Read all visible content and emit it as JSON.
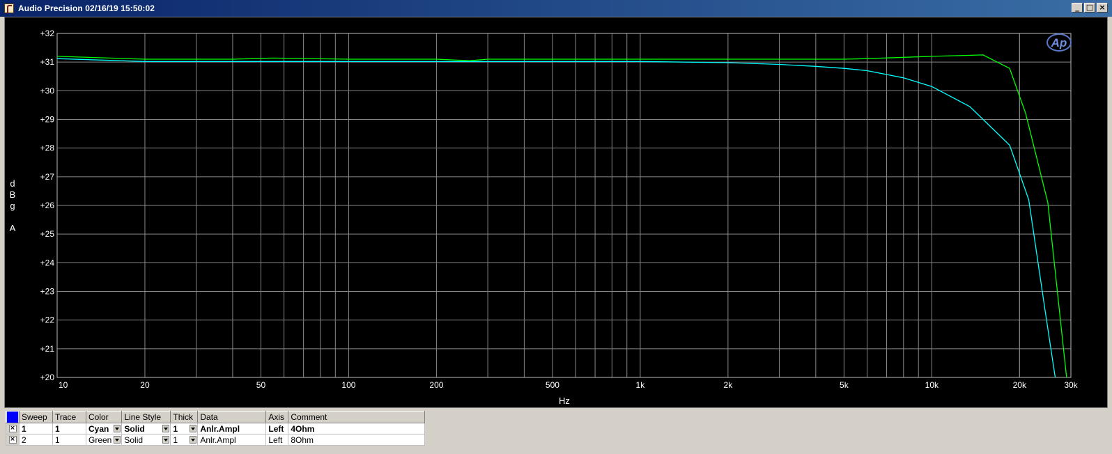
{
  "window": {
    "title": "Audio Precision  02/16/19 15:50:02",
    "minimize_glyph": "_",
    "maximize_glyph": "□",
    "close_glyph": "×"
  },
  "chart_data": {
    "type": "line",
    "title": "",
    "xlabel": "Hz",
    "ylabel": "dBgA",
    "ylabel_chars": [
      "d",
      "B",
      "g",
      "",
      "A"
    ],
    "xscale": "log",
    "xlim": [
      10,
      30000
    ],
    "ylim": [
      20,
      32
    ],
    "grid": true,
    "logo": "Ap",
    "y_ticks": [
      {
        "v": 20,
        "label": "+20"
      },
      {
        "v": 21,
        "label": "+21"
      },
      {
        "v": 22,
        "label": "+22"
      },
      {
        "v": 23,
        "label": "+23"
      },
      {
        "v": 24,
        "label": "+24"
      },
      {
        "v": 25,
        "label": "+25"
      },
      {
        "v": 26,
        "label": "+26"
      },
      {
        "v": 27,
        "label": "+27"
      },
      {
        "v": 28,
        "label": "+28"
      },
      {
        "v": 29,
        "label": "+29"
      },
      {
        "v": 30,
        "label": "+30"
      },
      {
        "v": 31,
        "label": "+31"
      },
      {
        "v": 32,
        "label": "+32"
      }
    ],
    "x_ticks": [
      {
        "v": 10,
        "label": "10"
      },
      {
        "v": 20,
        "label": "20"
      },
      {
        "v": 50,
        "label": "50"
      },
      {
        "v": 100,
        "label": "100"
      },
      {
        "v": 200,
        "label": "200"
      },
      {
        "v": 500,
        "label": "500"
      },
      {
        "v": 1000,
        "label": "1k"
      },
      {
        "v": 2000,
        "label": "2k"
      },
      {
        "v": 5000,
        "label": "5k"
      },
      {
        "v": 10000,
        "label": "10k"
      },
      {
        "v": 20000,
        "label": "20k"
      },
      {
        "v": 30000,
        "label": "30k"
      }
    ],
    "series": [
      {
        "name": "4Ohm",
        "color": "#00ffff",
        "points": [
          [
            10,
            31.12
          ],
          [
            20,
            31.02
          ],
          [
            50,
            31.02
          ],
          [
            100,
            31.02
          ],
          [
            200,
            31.02
          ],
          [
            300,
            31.02
          ],
          [
            500,
            31.02
          ],
          [
            1000,
            31.02
          ],
          [
            2000,
            30.98
          ],
          [
            3000,
            30.92
          ],
          [
            4000,
            30.85
          ],
          [
            5000,
            30.78
          ],
          [
            6000,
            30.7
          ],
          [
            8000,
            30.45
          ],
          [
            10000,
            30.15
          ],
          [
            13500,
            29.45
          ],
          [
            18500,
            28.1
          ],
          [
            21500,
            26.2
          ],
          [
            24500,
            22.3
          ],
          [
            26500,
            20.0
          ]
        ]
      },
      {
        "name": "8Ohm",
        "color": "#00ff00",
        "points": [
          [
            10,
            31.2
          ],
          [
            20,
            31.1
          ],
          [
            40,
            31.1
          ],
          [
            55,
            31.14
          ],
          [
            100,
            31.1
          ],
          [
            200,
            31.1
          ],
          [
            260,
            31.05
          ],
          [
            300,
            31.1
          ],
          [
            500,
            31.1
          ],
          [
            1000,
            31.1
          ],
          [
            2000,
            31.1
          ],
          [
            5000,
            31.1
          ],
          [
            6000,
            31.12
          ],
          [
            10000,
            31.2
          ],
          [
            15000,
            31.25
          ],
          [
            18500,
            30.78
          ],
          [
            21000,
            29.2
          ],
          [
            25000,
            26.1
          ],
          [
            29000,
            20.0
          ]
        ]
      }
    ]
  },
  "legend": {
    "headers": [
      "Sweep",
      "Trace",
      "Color",
      "Line Style",
      "Thick",
      "Data",
      "Axis",
      "Comment"
    ],
    "rows": [
      {
        "checked": "×",
        "sweep": "1",
        "trace": "1",
        "color": "Cyan",
        "line_style": "Solid",
        "thick": "1",
        "data": "Anlr.Ampl",
        "axis": "Left",
        "comment": "4Ohm"
      },
      {
        "checked": "×",
        "sweep": "2",
        "trace": "1",
        "color": "Green",
        "line_style": "Solid",
        "thick": "1",
        "data": "Anlr.Ampl",
        "axis": "Left",
        "comment": "8Ohm"
      }
    ]
  }
}
